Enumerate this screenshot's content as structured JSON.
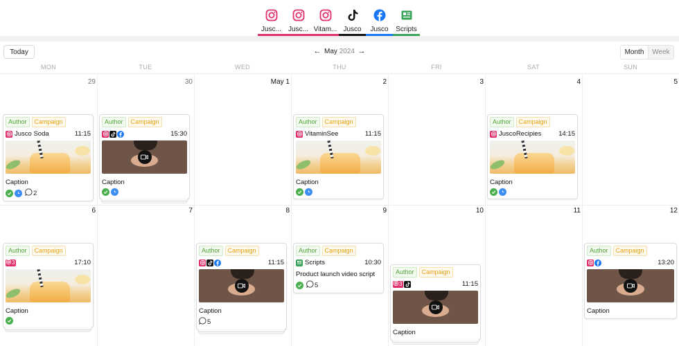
{
  "tabs": [
    {
      "label": "Jusc...",
      "icon": "instagram-icon",
      "color": "#e1306c"
    },
    {
      "label": "Jusc...",
      "icon": "instagram-icon",
      "color": "#e1306c"
    },
    {
      "label": "Vitam...",
      "icon": "instagram-icon",
      "color": "#e1306c"
    },
    {
      "label": "Jusco",
      "icon": "tiktok-icon",
      "color": "#111111"
    },
    {
      "label": "Jusco",
      "icon": "facebook-icon",
      "color": "#1877f2"
    },
    {
      "label": "Scripts",
      "icon": "scripts-icon",
      "color": "#3aa55a"
    }
  ],
  "toolbar": {
    "today_label": "Today",
    "month": "May",
    "year": "2024",
    "view_month": "Month",
    "view_week": "Week"
  },
  "weekdays": [
    "MON",
    "TUE",
    "WED",
    "THU",
    "FRI",
    "SAT",
    "SUN"
  ],
  "week1": [
    "29",
    "30",
    "May 1",
    "2",
    "3",
    "4",
    "5"
  ],
  "week2": [
    "6",
    "7",
    "8",
    "9",
    "10",
    "11",
    "12"
  ],
  "tag_author": "Author",
  "tag_campaign": "Campaign",
  "cards": {
    "c1": {
      "account": "Jusco Soda",
      "time": "11:15",
      "caption": "Caption",
      "comments": "2"
    },
    "c2": {
      "time": "15:30",
      "caption": "Caption"
    },
    "c3": {
      "account": "VitaminSee",
      "time": "11:15",
      "caption": "Caption"
    },
    "c4": {
      "account": "JuscoRecipies",
      "time": "14:15",
      "caption": "Caption"
    },
    "c5": {
      "count": "3",
      "time": "17:10",
      "caption": "Caption"
    },
    "c6": {
      "time": "11:15",
      "caption": "Caption",
      "comments": "5"
    },
    "c7": {
      "account": "Scripts",
      "time": "10:30",
      "text": "Product launch video script",
      "comments": "5"
    },
    "c8": {
      "count": "3",
      "time": "11:15",
      "caption": "Caption"
    },
    "c9": {
      "time": "13:20",
      "caption": "Caption"
    }
  }
}
